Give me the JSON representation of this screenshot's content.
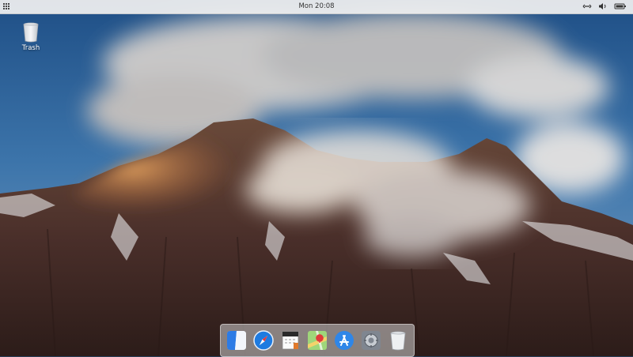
{
  "topbar": {
    "clock": "Mon 20:08",
    "tray_icons": [
      "network-icon",
      "volume-icon",
      "battery-icon"
    ]
  },
  "desktop": {
    "icons": [
      {
        "label": "Trash",
        "icon": "trash-icon"
      }
    ]
  },
  "dock": {
    "items": [
      {
        "name": "finder",
        "icon": "finder-icon"
      },
      {
        "name": "safari",
        "icon": "safari-compass-icon"
      },
      {
        "name": "calendar",
        "icon": "calendar-icon"
      },
      {
        "name": "maps",
        "icon": "maps-icon"
      },
      {
        "name": "app-store",
        "icon": "app-store-icon"
      },
      {
        "name": "system-preferences",
        "icon": "gear-icon"
      },
      {
        "name": "trash",
        "icon": "trash-icon"
      }
    ]
  },
  "colors": {
    "sky": "#2f5f95",
    "rock": "#4a2f2a",
    "cloud": "#e9e2da",
    "glow": "#d48a4a"
  }
}
